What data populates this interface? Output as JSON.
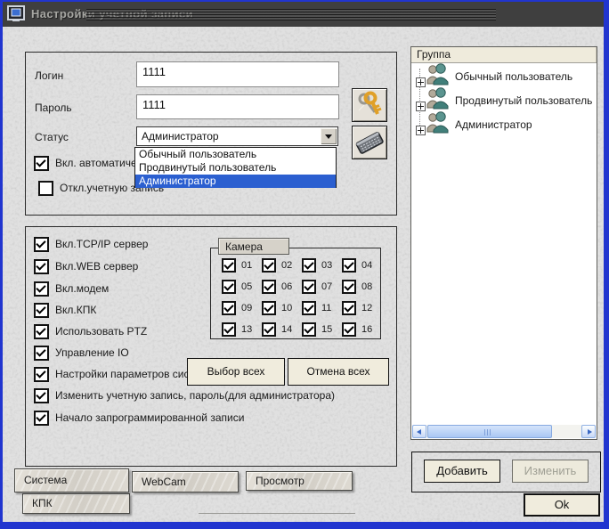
{
  "window": {
    "title": "Настройки учетной записи",
    "titlebar_color": "#3f3f3f",
    "frame_color": "#2135cf"
  },
  "account": {
    "login_label": "Логин",
    "login_value": "1111",
    "password_label": "Пароль",
    "password_value": "1111",
    "status_label": "Статус",
    "status_value": "Администратор",
    "status_options": [
      {
        "label": "Обычный пользователь",
        "selected": false
      },
      {
        "label": "Продвинутый пользователь",
        "selected": false
      },
      {
        "label": "Администратор",
        "selected": true
      }
    ],
    "auto_login": {
      "label": "Вкл. автоматическ",
      "checked": true
    },
    "disable_account": {
      "label": "Откл.учетную запись",
      "checked": false
    }
  },
  "permissions": [
    {
      "label": "Вкл.TCP/IP сервер",
      "checked": true
    },
    {
      "label": "Вкл.WEB сервер",
      "checked": true
    },
    {
      "label": "Вкл.модем",
      "checked": true
    },
    {
      "label": "Вкл.КПК",
      "checked": true
    },
    {
      "label": "Использовать PTZ",
      "checked": true
    },
    {
      "label": "Управление IO",
      "checked": true
    },
    {
      "label": "Настройки параметров систе",
      "checked": true
    },
    {
      "label": "Изменить учетную запись, пароль(для администратора)",
      "checked": true
    },
    {
      "label": "Начало запрограммированной записи",
      "checked": true
    }
  ],
  "cameras": {
    "group_label": "Камера",
    "items": [
      {
        "label": "01",
        "checked": true
      },
      {
        "label": "02",
        "checked": true
      },
      {
        "label": "03",
        "checked": true
      },
      {
        "label": "04",
        "checked": true
      },
      {
        "label": "05",
        "checked": true
      },
      {
        "label": "06",
        "checked": true
      },
      {
        "label": "07",
        "checked": true
      },
      {
        "label": "08",
        "checked": true
      },
      {
        "label": "09",
        "checked": true
      },
      {
        "label": "10",
        "checked": true
      },
      {
        "label": "11",
        "checked": true
      },
      {
        "label": "12",
        "checked": true
      },
      {
        "label": "13",
        "checked": true
      },
      {
        "label": "14",
        "checked": true
      },
      {
        "label": "15",
        "checked": true
      },
      {
        "label": "16",
        "checked": true
      }
    ],
    "select_all": "Выбор всех",
    "deselect_all": "Отмена всех"
  },
  "tabs": {
    "items": [
      {
        "label": "Система",
        "active": true
      },
      {
        "label": "WebCam",
        "active": false
      },
      {
        "label": "Просмотр",
        "active": false
      },
      {
        "label": "КПК",
        "active": false
      }
    ]
  },
  "group_panel": {
    "header": "Группа",
    "items": [
      {
        "label": "Обычный пользователь"
      },
      {
        "label": "Продвинутый пользователь"
      },
      {
        "label": "Администратор"
      }
    ],
    "add_button": "Добавить",
    "edit_button": "Изменить",
    "edit_disabled": true
  },
  "ok_button": "Ok",
  "colors": {
    "selection_blue": "#2b5fd0",
    "button_face": "#f0ecdd",
    "titlebar": "#3f3f3f",
    "window_border_blue": "#2135cf",
    "scrollbar_blue": "#a9c7f3"
  }
}
